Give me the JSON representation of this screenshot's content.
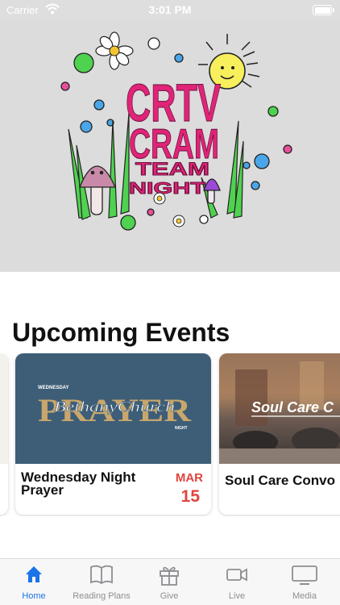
{
  "status_bar": {
    "carrier": "Carrier",
    "time": "3:01 PM"
  },
  "hero": {
    "logo_lines": [
      "CRTV",
      "CRAM",
      "TEAM",
      "NIGHT"
    ],
    "background": "#dcdcdc"
  },
  "section": {
    "title": "Upcoming Events"
  },
  "events": [
    {
      "title": "Wednesday Night Prayer",
      "month": "MAR",
      "day": "15",
      "image_text": {
        "top": "WEDNESDAY",
        "main": "PRAYER",
        "script": "BethanyChurch",
        "bottom": "NIGHT"
      }
    },
    {
      "title": "Soul Care Convo",
      "image_text": {
        "main": "Soul Care C"
      }
    }
  ],
  "tabs": [
    {
      "label": "Home",
      "icon": "home-icon",
      "active": true
    },
    {
      "label": "Reading Plans",
      "icon": "book-icon",
      "active": false
    },
    {
      "label": "Give",
      "icon": "gift-icon",
      "active": false
    },
    {
      "label": "Live",
      "icon": "video-icon",
      "active": false
    },
    {
      "label": "Media",
      "icon": "tv-icon",
      "active": false
    }
  ],
  "colors": {
    "accent": "#1a73e8",
    "date": "#e0443d",
    "prayer_bg": "#3e5e77",
    "prayer_text": "#c9a66b"
  }
}
